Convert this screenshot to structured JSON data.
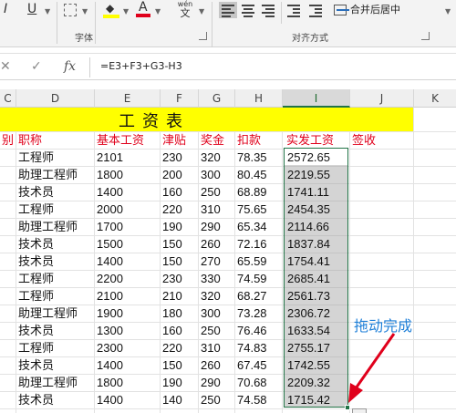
{
  "ribbon": {
    "bold": "I",
    "underline": "U",
    "font_color_glyph": "A",
    "phonetic_top": "wén",
    "phonetic_bottom": "文",
    "font_group_label": "字体",
    "merge_label": "合并后居中",
    "align_group_label": "对齐方式"
  },
  "formula_bar": {
    "cancel": "✕",
    "confirm": "✓",
    "fx": "fx",
    "formula": "=E3+F3+G3-H3"
  },
  "columns": [
    "C",
    "D",
    "E",
    "F",
    "G",
    "H",
    "I",
    "J",
    "K"
  ],
  "sheet": {
    "title": "工资表",
    "headers": {
      "c": "别",
      "d": "职称",
      "e": "基本工资",
      "f": "津贴",
      "g": "奖金",
      "h": "扣款",
      "i": "实发工资",
      "j": "签收"
    },
    "rows": [
      {
        "d": "工程师",
        "e": "2101",
        "f": "230",
        "g": "320",
        "h": "78.35",
        "i": "2572.65"
      },
      {
        "d": "助理工程师",
        "e": "1800",
        "f": "200",
        "g": "300",
        "h": "80.45",
        "i": "2219.55"
      },
      {
        "d": "技术员",
        "e": "1400",
        "f": "160",
        "g": "250",
        "h": "68.89",
        "i": "1741.11"
      },
      {
        "d": "工程师",
        "e": "2000",
        "f": "220",
        "g": "310",
        "h": "75.65",
        "i": "2454.35"
      },
      {
        "d": "助理工程师",
        "e": "1700",
        "f": "190",
        "g": "290",
        "h": "65.34",
        "i": "2114.66"
      },
      {
        "d": "技术员",
        "e": "1500",
        "f": "150",
        "g": "260",
        "h": "72.16",
        "i": "1837.84"
      },
      {
        "d": "技术员",
        "e": "1400",
        "f": "150",
        "g": "270",
        "h": "65.59",
        "i": "1754.41"
      },
      {
        "d": "工程师",
        "e": "2200",
        "f": "230",
        "g": "330",
        "h": "74.59",
        "i": "2685.41"
      },
      {
        "d": "工程师",
        "e": "2100",
        "f": "210",
        "g": "320",
        "h": "68.27",
        "i": "2561.73"
      },
      {
        "d": "助理工程师",
        "e": "1900",
        "f": "180",
        "g": "300",
        "h": "73.28",
        "i": "2306.72"
      },
      {
        "d": "技术员",
        "e": "1300",
        "f": "160",
        "g": "250",
        "h": "76.46",
        "i": "1633.54"
      },
      {
        "d": "工程师",
        "e": "2300",
        "f": "220",
        "g": "310",
        "h": "74.83",
        "i": "2755.17"
      },
      {
        "d": "技术员",
        "e": "1400",
        "f": "150",
        "g": "260",
        "h": "67.45",
        "i": "1742.55"
      },
      {
        "d": "助理工程师",
        "e": "1800",
        "f": "190",
        "g": "290",
        "h": "70.68",
        "i": "2209.32"
      },
      {
        "d": "技术员",
        "e": "1400",
        "f": "140",
        "g": "250",
        "h": "74.58",
        "i": "1715.42"
      }
    ]
  },
  "annotation": "拖动完成",
  "colors": {
    "title_fill": "#ffff00",
    "header_text": "#e0001b",
    "selection_border": "#217346",
    "annotation": "#1e7fd8"
  }
}
